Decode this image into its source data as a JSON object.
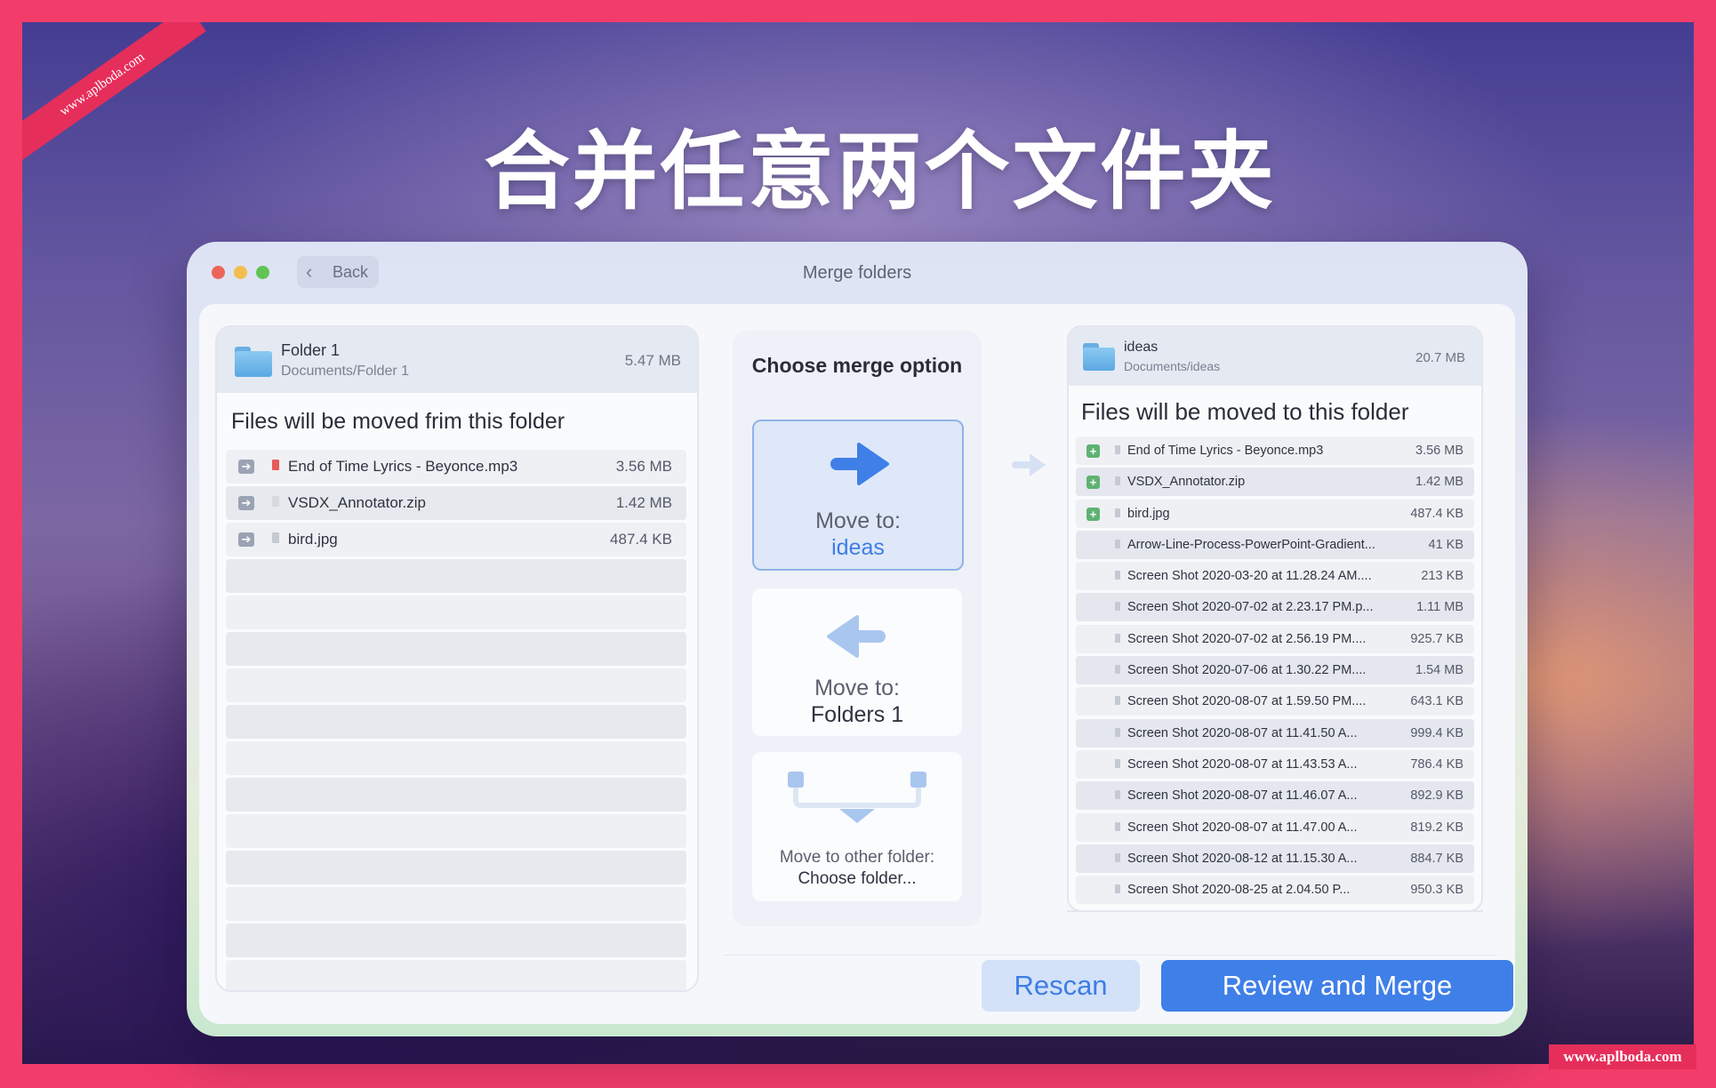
{
  "watermark_top": "www.aplboda.com",
  "watermark_bottom": "www.aplboda.com",
  "headline": "合并任意两个文件夹",
  "window": {
    "back_label": "Back",
    "title": "Merge folders"
  },
  "source": {
    "name": "Folder 1",
    "path": "Documents/Folder 1",
    "size": "5.47 MB",
    "caption": "Files will be moved frim this folder",
    "files": [
      {
        "name": "End of Time Lyrics - Beyonce.mp3",
        "size": "3.56 MB",
        "icon": "audio-file-icon",
        "color": "#e85a5a"
      },
      {
        "name": "VSDX_Annotator.zip",
        "size": "1.42 MB",
        "icon": "zip-file-icon",
        "color": "#d6d9e0"
      },
      {
        "name": "bird.jpg",
        "size": "487.4 KB",
        "icon": "image-file-icon",
        "color": "#c5c9d2"
      }
    ]
  },
  "merge": {
    "heading": "Choose merge option",
    "option1": {
      "line1": "Move to:",
      "line2": "ideas",
      "icon": "arrow-right-icon"
    },
    "option2": {
      "line1": "Move to:",
      "line2": "Folders 1",
      "icon": "arrow-left-icon"
    },
    "option3": {
      "line1": "Move to other folder:",
      "line2": "Choose folder...",
      "icon": "merge-down-icon"
    }
  },
  "destination": {
    "name": "ideas",
    "path": "Documents/ideas",
    "size": "20.7 MB",
    "caption": "Files will be moved to this folder",
    "files": [
      {
        "name": "End of Time Lyrics - Beyonce.mp3",
        "size": "3.56 MB",
        "new": true
      },
      {
        "name": "VSDX_Annotator.zip",
        "size": "1.42 MB",
        "new": true
      },
      {
        "name": "bird.jpg",
        "size": "487.4 KB",
        "new": true
      },
      {
        "name": "Arrow-Line-Process-PowerPoint-Gradient...",
        "size": "41 KB",
        "new": false
      },
      {
        "name": "Screen Shot 2020-03-20 at 11.28.24 AM....",
        "size": "213 KB",
        "new": false
      },
      {
        "name": "Screen Shot 2020-07-02 at 2.23.17 PM.p...",
        "size": "1.11 MB",
        "new": false
      },
      {
        "name": "Screen Shot 2020-07-02 at 2.56.19 PM....",
        "size": "925.7 KB",
        "new": false
      },
      {
        "name": "Screen Shot 2020-07-06 at 1.30.22 PM....",
        "size": "1.54 MB",
        "new": false
      },
      {
        "name": "Screen Shot 2020-08-07 at 1.59.50 PM....",
        "size": "643.1 KB",
        "new": false
      },
      {
        "name": "Screen Shot 2020-08-07 at 11.41.50 A...",
        "size": "999.4 KB",
        "new": false
      },
      {
        "name": "Screen Shot 2020-08-07 at 11.43.53 A...",
        "size": "786.4 KB",
        "new": false
      },
      {
        "name": "Screen Shot 2020-08-07 at 11.46.07 A...",
        "size": "892.9 KB",
        "new": false
      },
      {
        "name": "Screen Shot 2020-08-07 at 11.47.00 A...",
        "size": "819.2 KB",
        "new": false
      },
      {
        "name": "Screen Shot 2020-08-12 at 11.15.30 A...",
        "size": "884.7 KB",
        "new": false
      },
      {
        "name": "Screen Shot 2020-08-25 at 2.04.50 P...",
        "size": "950.3 KB",
        "new": false
      }
    ]
  },
  "buttons": {
    "rescan": "Rescan",
    "merge": "Review and Merge"
  },
  "colors": {
    "accent": "#3f7fe8",
    "new_badge": "#5fb273",
    "frame": "#f23d6a"
  }
}
